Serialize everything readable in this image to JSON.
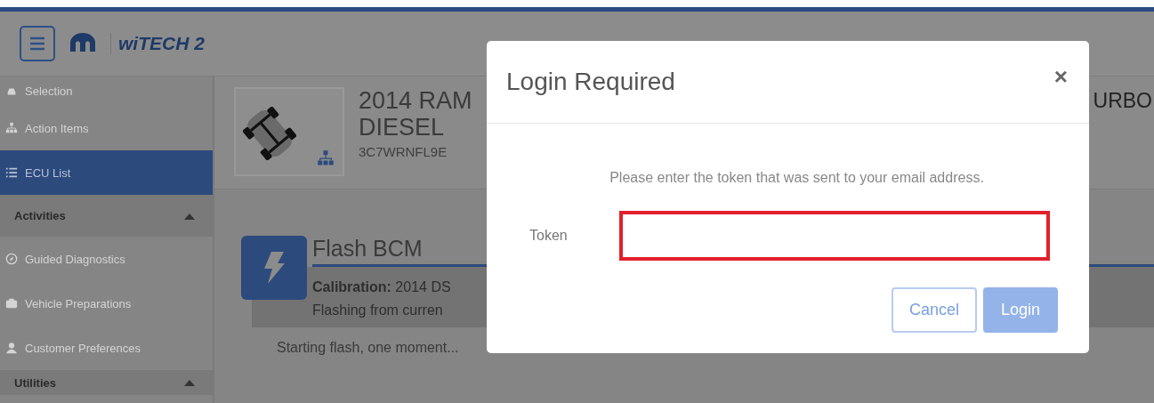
{
  "header": {
    "logo_text": "wiTECH 2"
  },
  "sidebar": {
    "items": [
      {
        "kind": "item",
        "label": "Selection",
        "selected": false
      },
      {
        "kind": "item",
        "label": "Action Items",
        "selected": false
      },
      {
        "kind": "item",
        "label": "ECU List",
        "selected": true
      },
      {
        "kind": "section",
        "label": "Activities",
        "expanded": true
      },
      {
        "kind": "item",
        "label": "Guided Diagnostics",
        "selected": false
      },
      {
        "kind": "item",
        "label": "Vehicle Preparations",
        "selected": false
      },
      {
        "kind": "item",
        "label": "Customer Preferences",
        "selected": false
      },
      {
        "kind": "section",
        "label": "Utilities",
        "expanded": true
      }
    ]
  },
  "vehicle": {
    "title_start": "2014 RAM",
    "title_end": "URBO",
    "title_line_2": "DIESEL",
    "vin": "3C7WRNFL9E"
  },
  "flash": {
    "title": "Flash BCM",
    "calibration_label": "Calibration:",
    "calibration_value": "2014 DS",
    "status_line": "Flashing from curren",
    "log": "Starting flash, one moment..."
  },
  "dialog": {
    "title": "Login Required",
    "close": "×",
    "message": "Please enter the token that was sent to your email address.",
    "field_label": "Token",
    "field_highlighted": true,
    "buttons": [
      {
        "label": "Cancel",
        "kind": "secondary",
        "disabled": false
      },
      {
        "label": "Login",
        "kind": "primary",
        "disabled": true
      }
    ]
  }
}
